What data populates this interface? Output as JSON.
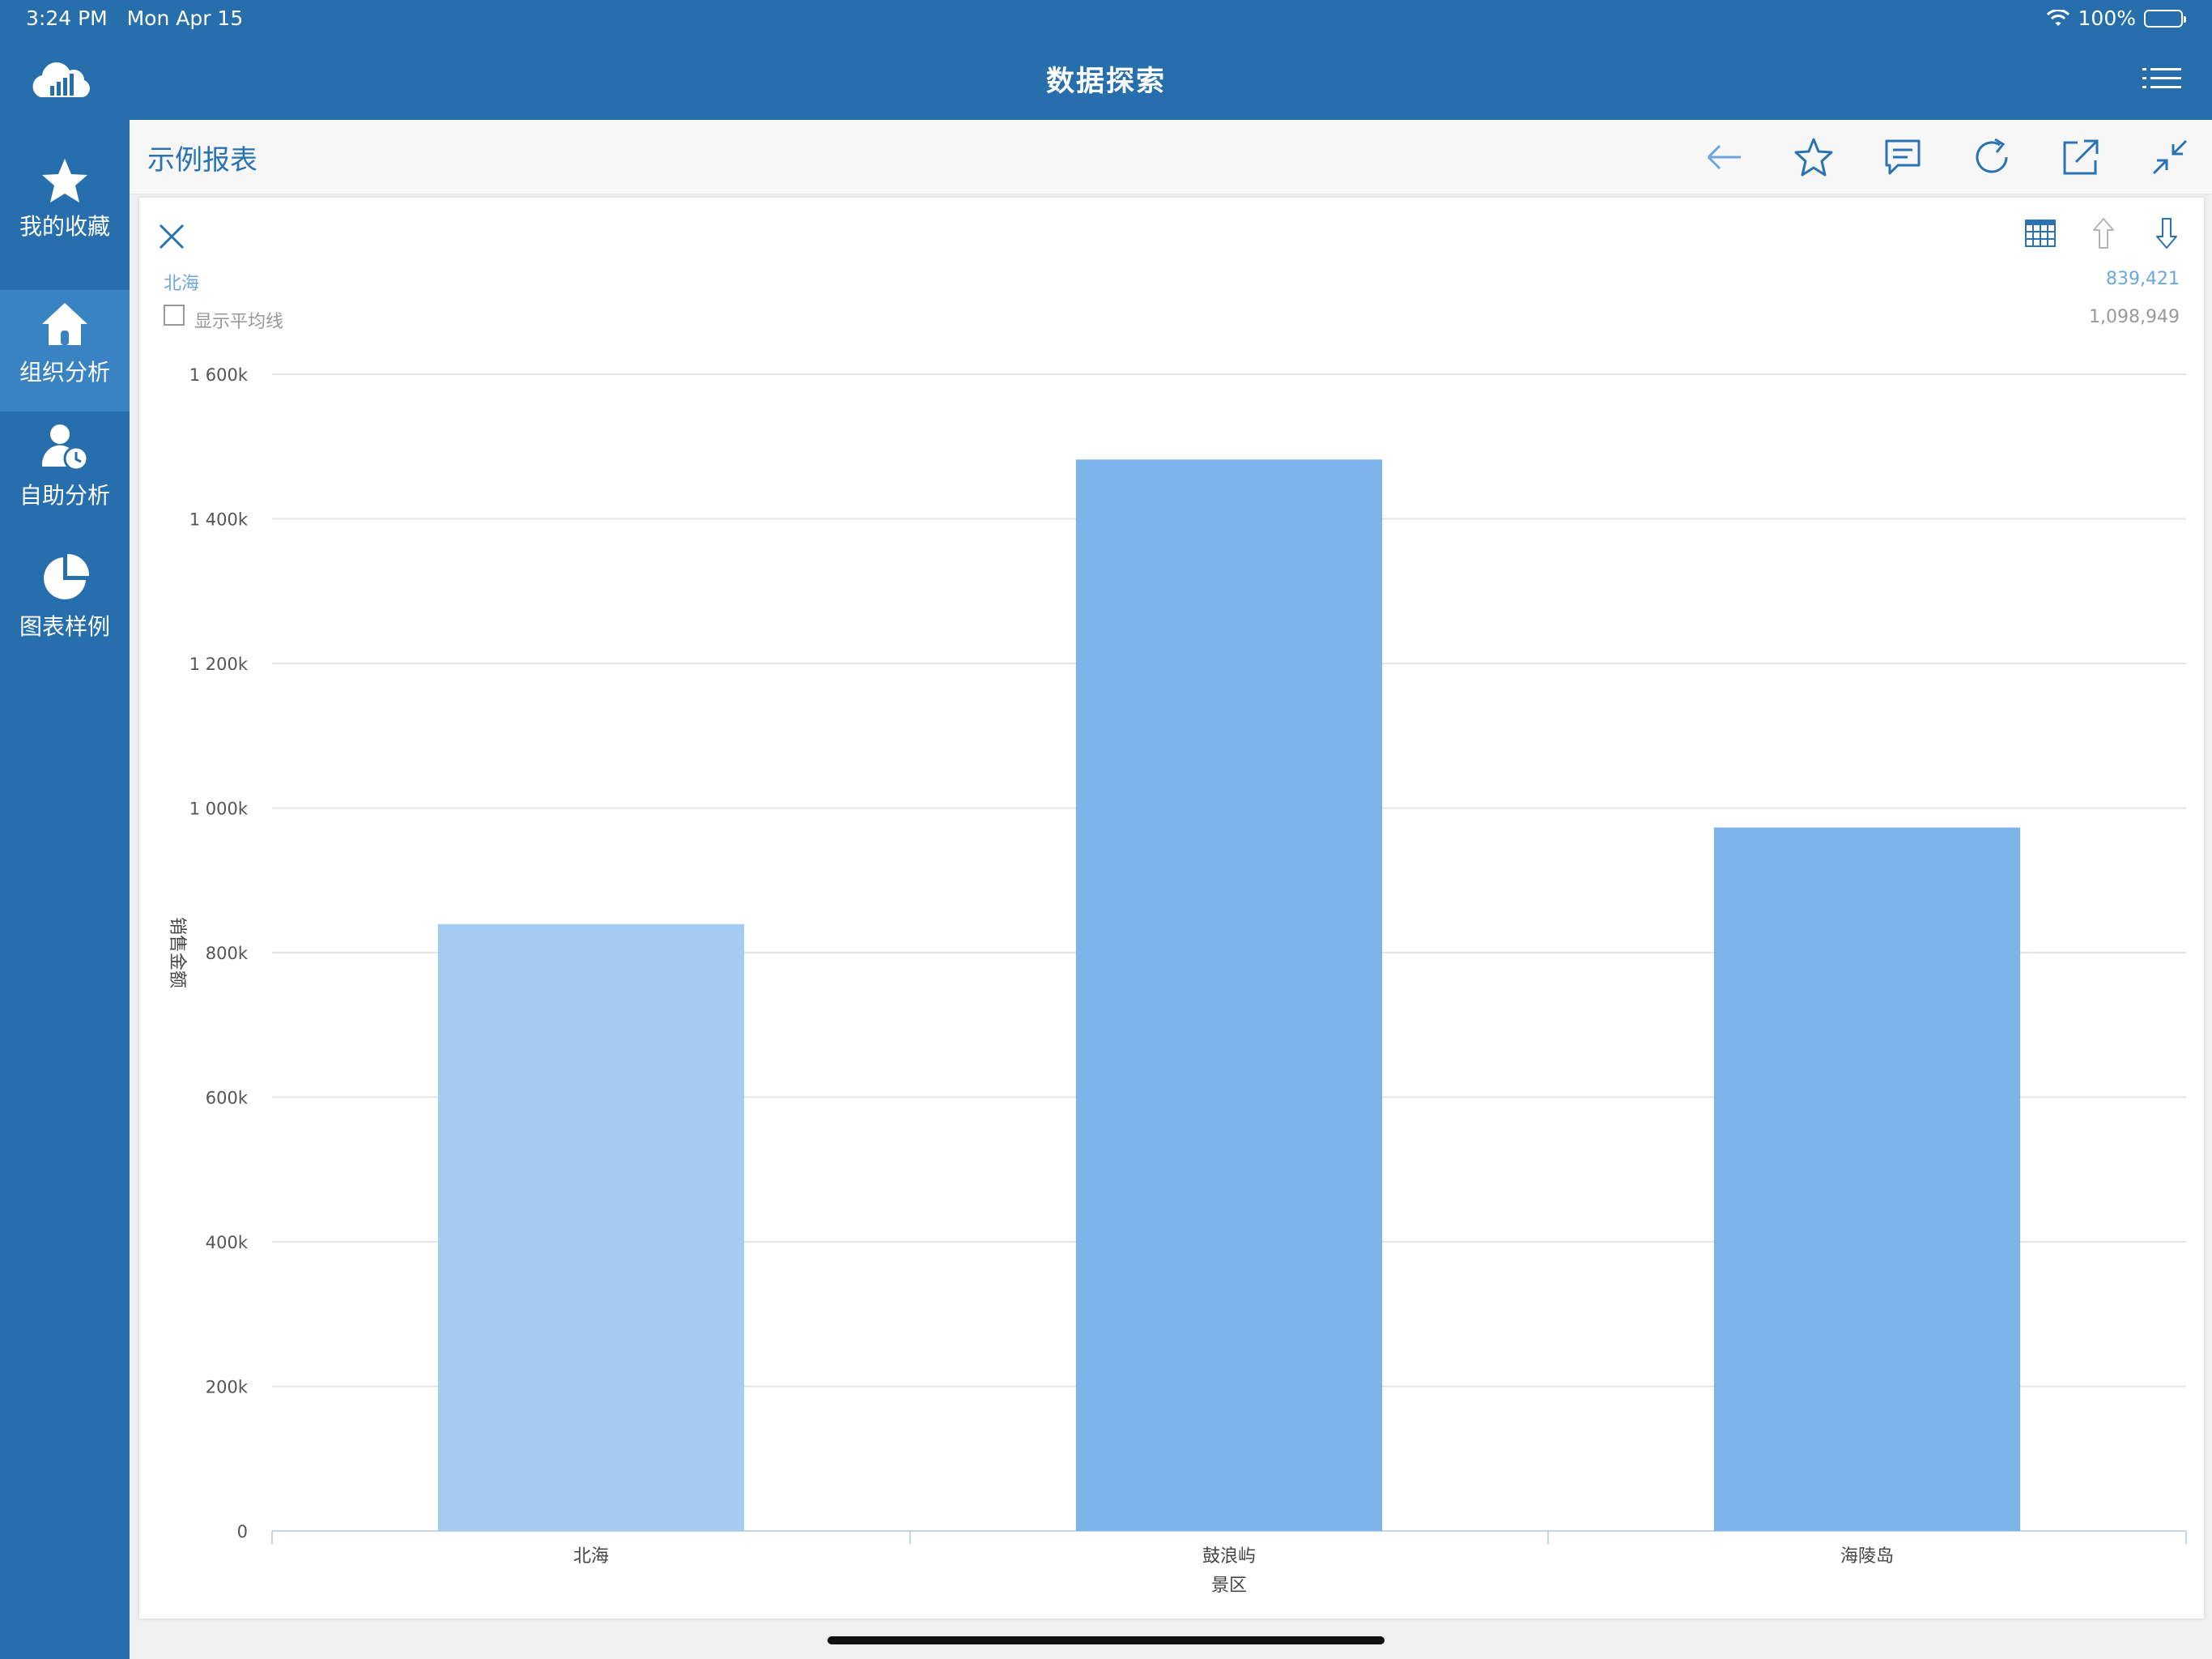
{
  "status": {
    "time": "3:24 PM",
    "date": "Mon Apr 15",
    "battery": "100%"
  },
  "app": {
    "title": "数据探索",
    "icons": [
      "cloud-logo-icon",
      "list-menu-icon"
    ]
  },
  "sidebar": {
    "items": [
      {
        "label": "我的收藏",
        "icon": "star-icon",
        "active": false
      },
      {
        "label": "组织分析",
        "icon": "home-icon",
        "active": true
      },
      {
        "label": "自助分析",
        "icon": "user-clock-icon",
        "active": false
      },
      {
        "label": "图表样例",
        "icon": "pie-chart-icon",
        "active": false
      }
    ]
  },
  "report": {
    "title": "示例报表",
    "toolbar": [
      "back-arrow-icon",
      "star-outline-icon",
      "comment-icon",
      "refresh-icon",
      "share-icon",
      "collapse-icon"
    ]
  },
  "panel": {
    "selected_name": "北海",
    "selected_value": "839,421",
    "avg_label": "显示平均线",
    "avg_value": "1,098,949",
    "tools": [
      "table-view-icon",
      "sort-ascending-icon",
      "sort-descending-icon"
    ]
  },
  "colors": {
    "bar": "#7cb3ea",
    "bar_highlight": "#a5cbf1",
    "topbar": "#266fac",
    "grid": "#e4e4e4"
  },
  "chart_data": {
    "type": "bar",
    "categories": [
      "北海",
      "鼓浪屿",
      "海陵岛"
    ],
    "values": [
      839421,
      1482000,
      973000
    ],
    "highlight_index": 0,
    "xlabel": "景区",
    "ylabel": "销售金额",
    "ylim": [
      0,
      1600000
    ],
    "yticks": [
      0,
      200000,
      400000,
      600000,
      800000,
      1000000,
      1200000,
      1400000,
      1600000
    ],
    "ytick_labels": [
      "0",
      "200k",
      "400k",
      "600k",
      "800k",
      "1 000k",
      "1 200k",
      "1 400k",
      "1 600k"
    ],
    "grid": true
  }
}
